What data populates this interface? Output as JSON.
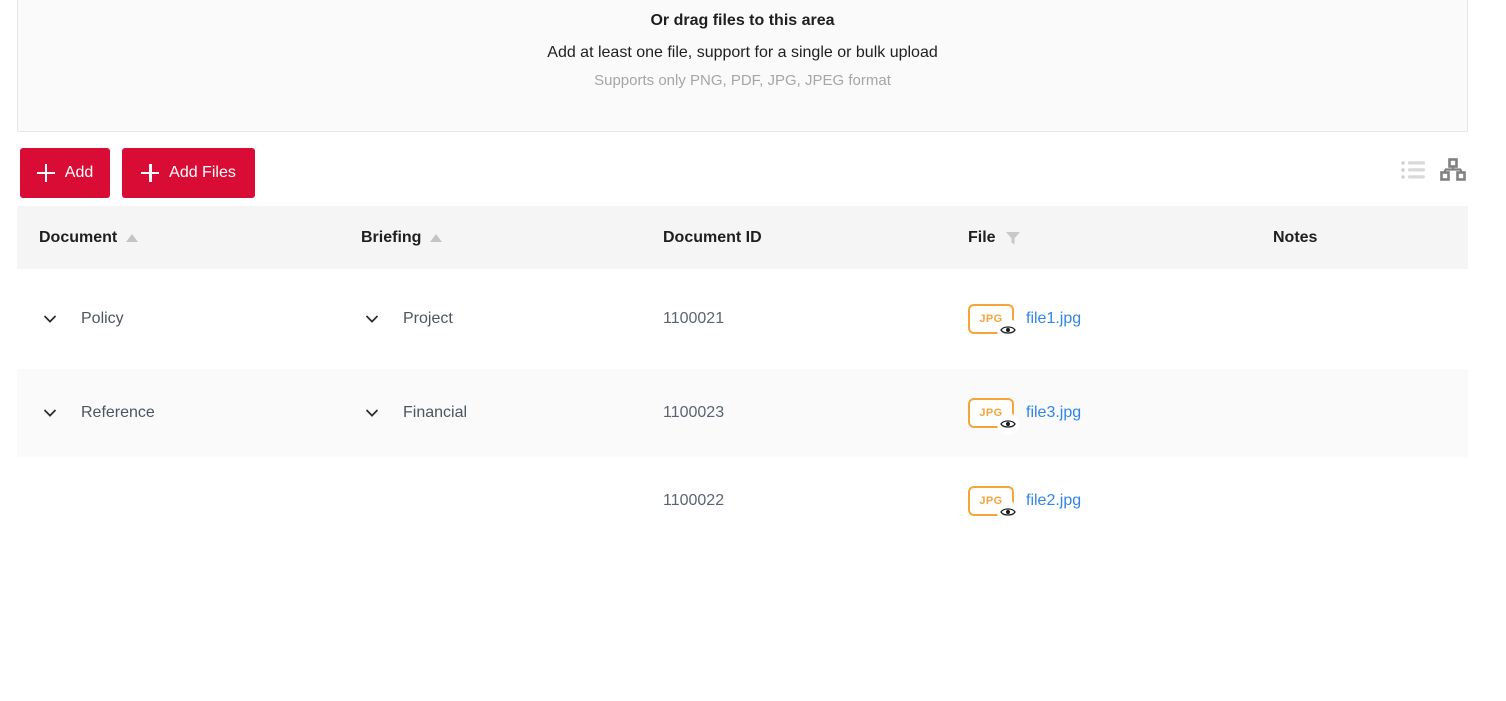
{
  "upload": {
    "title": "Or drag files to this area",
    "subtitle": "Add at least one file, support for a single or bulk upload",
    "hint": "Supports only PNG, PDF, JPG, JPEG format"
  },
  "toolbar": {
    "add_label": "Add",
    "add_files_label": "Add Files",
    "accent_color": "#d80c35",
    "views": [
      {
        "name": "list-view",
        "active": false
      },
      {
        "name": "tree-view",
        "active": true
      }
    ]
  },
  "table": {
    "columns": [
      {
        "label": "Document",
        "sortable": true,
        "sort": "asc",
        "filter": false
      },
      {
        "label": "Briefing",
        "sortable": true,
        "sort": "asc",
        "filter": false
      },
      {
        "label": "Document ID",
        "sortable": false,
        "sort": null,
        "filter": false
      },
      {
        "label": "File",
        "sortable": false,
        "sort": null,
        "filter": true
      },
      {
        "label": "Notes",
        "sortable": false,
        "sort": null,
        "filter": false
      }
    ],
    "rows": [
      {
        "document": "Policy",
        "briefing": "Project",
        "document_id": "1100021",
        "file": {
          "name": "file1.jpg",
          "ext": "JPG",
          "color": "#f5a43b",
          "link_color": "#2f86e8"
        },
        "notes": "",
        "expandable_document": true,
        "expandable_briefing": true,
        "highlighted": false
      },
      {
        "document": "Reference",
        "briefing": "Financial",
        "document_id": "1100023",
        "file": {
          "name": "file3.jpg",
          "ext": "JPG",
          "color": "#f5a43b",
          "link_color": "#2f86e8"
        },
        "notes": "",
        "expandable_document": true,
        "expandable_briefing": true,
        "highlighted": true
      },
      {
        "document": "",
        "briefing": "",
        "document_id": "1100022",
        "file": {
          "name": "file2.jpg",
          "ext": "JPG",
          "color": "#f5a43b",
          "link_color": "#2f86e8"
        },
        "notes": "",
        "expandable_document": false,
        "expandable_briefing": false,
        "highlighted": false
      }
    ]
  }
}
